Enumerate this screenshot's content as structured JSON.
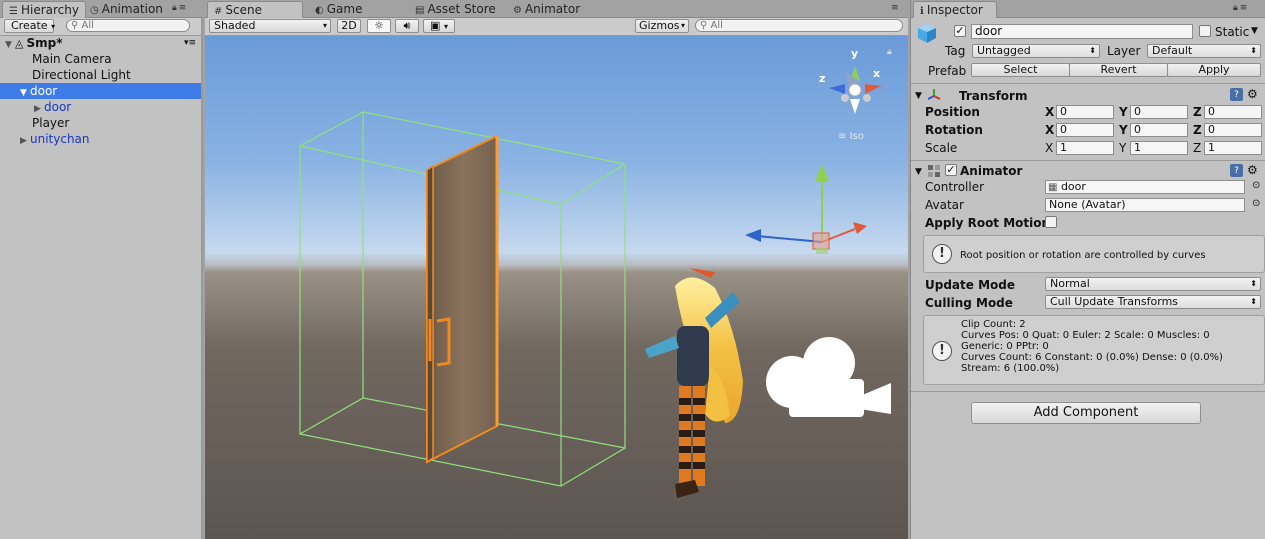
{
  "hierarchy": {
    "tabs": [
      "Hierarchy",
      "Animation"
    ],
    "create_label": "Create",
    "search_placeholder": "All",
    "scene_name": "Smp*",
    "items": [
      "Main Camera",
      "Directional Light",
      "door",
      "door",
      "Player",
      "unitychan"
    ]
  },
  "scene": {
    "tabs": [
      "Scene",
      "Game",
      "Asset Store",
      "Animator"
    ],
    "shading_mode": "Shaded",
    "toggle_2d": "2D",
    "gizmos_label": "Gizmos",
    "search_placeholder": "All",
    "gizmo_axes": {
      "y": "y",
      "x": "x",
      "z": "z"
    },
    "projection": "Iso"
  },
  "inspector": {
    "tab": "Inspector",
    "object_name": "door",
    "static_label": "Static",
    "tag_label": "Tag",
    "tag_value": "Untagged",
    "layer_label": "Layer",
    "layer_value": "Default",
    "prefab_label": "Prefab",
    "prefab_buttons": [
      "Select",
      "Revert",
      "Apply"
    ],
    "transform": {
      "title": "Transform",
      "position_label": "Position",
      "rotation_label": "Rotation",
      "scale_label": "Scale",
      "axis_labels": [
        "X",
        "Y",
        "Z"
      ],
      "position": [
        "0",
        "0",
        "0"
      ],
      "rotation": [
        "0",
        "0",
        "0"
      ],
      "scale": [
        "1",
        "1",
        "1"
      ]
    },
    "animator": {
      "title": "Animator",
      "controller_label": "Controller",
      "controller_value": "door",
      "avatar_label": "Avatar",
      "avatar_value": "None (Avatar)",
      "root_motion_label": "Apply Root Motion",
      "root_motion_info": "Root position or rotation are controlled by curves",
      "update_mode_label": "Update Mode",
      "update_mode_value": "Normal",
      "culling_mode_label": "Culling Mode",
      "culling_mode_value": "Cull Update Transforms",
      "clip_info": [
        "Clip Count: 2",
        "Curves Pos: 0 Quat: 0 Euler: 2 Scale: 0 Muscles: 0",
        "Generic: 0 PPtr: 0",
        "Curves Count: 6 Constant: 0 (0.0%) Dense: 0 (0.0%)",
        "Stream: 6 (100.0%)"
      ]
    },
    "add_component_label": "Add Component"
  },
  "colors": {
    "selection": "#3e7de7",
    "panel_bg": "#c2c2c2",
    "selection_outline": "#f08a1e",
    "bounds_wire": "#8ee27a"
  }
}
